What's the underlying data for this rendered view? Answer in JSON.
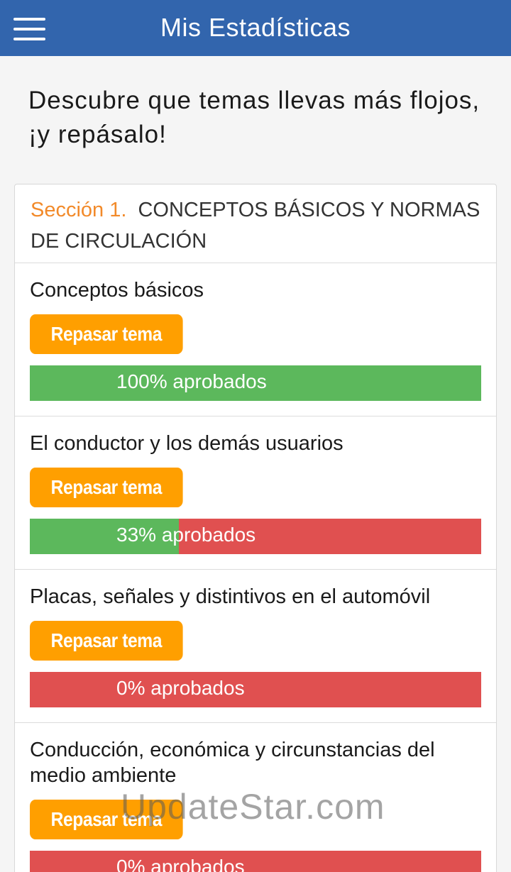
{
  "app_bar": {
    "title": "Mis Estadísticas",
    "menu_icon": "hamburger-menu-icon",
    "background": "#3265ad"
  },
  "intro_text": "Descubre que temas llevas más flojos, ¡y repásalo!",
  "section": {
    "number_label": "Sección 1.",
    "title": "CONCEPTOS BÁSICOS Y NORMAS DE CIRCULACIÓN"
  },
  "colors": {
    "accent_orange": "#ff9f00",
    "section_orange": "#f28a2a",
    "pass_green": "#5cb85c",
    "fail_red": "#e05050"
  },
  "topics": [
    {
      "title": "Conceptos básicos",
      "button_label": "Repasar tema",
      "progress_label": "100% aprobados",
      "approved_fraction": 1.0
    },
    {
      "title": "El conductor y los demás usuarios",
      "button_label": "Repasar tema",
      "progress_label": "33% aprobados",
      "approved_fraction": 0.33
    },
    {
      "title": "Placas, señales y distintivos en el automóvil",
      "button_label": "Repasar tema",
      "progress_label": "0% aprobados",
      "approved_fraction": 0.0
    },
    {
      "title": "Conducción, económica y circunstancias del medio ambiente",
      "button_label": "Repasar tema",
      "progress_label": "0% aprobados",
      "approved_fraction": 0.0
    }
  ],
  "watermark": "UpdateStar.com"
}
